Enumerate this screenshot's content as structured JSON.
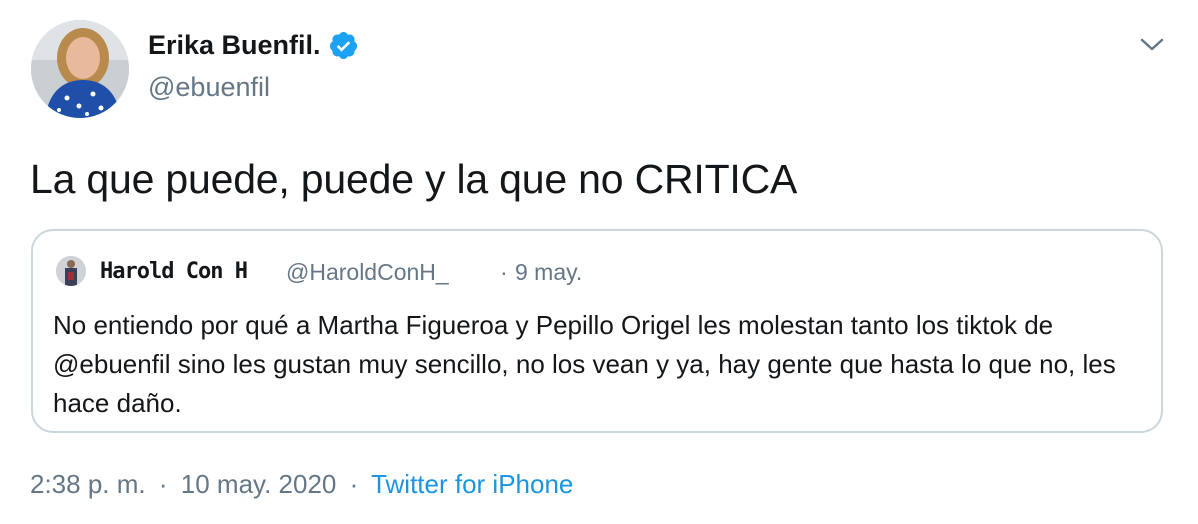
{
  "tweet": {
    "author": {
      "name": "Erika Buenfil.",
      "handle": "@ebuenfil",
      "verified": true
    },
    "text": "La que puede, puede y la que no CRITICA",
    "quoted": {
      "name": "Harold Con H",
      "handle": "@HaroldConH_",
      "separator": "·",
      "date": "9 may.",
      "text": "No entiendo por qué a Martha Figueroa y Pepillo Origel les molestan tanto los tiktok de @ebuenfil sino les gustan muy sencillo, no los vean y ya, hay gente que hasta lo que no, les hace daño."
    },
    "footer": {
      "time": "2:38 p. m.",
      "separator": "·",
      "date": "10 may. 2020",
      "source": "Twitter for iPhone"
    }
  },
  "icons": {
    "verified": "verified-badge-icon",
    "caret": "chevron-down-icon"
  },
  "colors": {
    "accent": "#1b95e0",
    "verified": "#1da1f2",
    "text_primary": "#14171a",
    "text_secondary": "#657786",
    "border": "#ccd6dd"
  }
}
